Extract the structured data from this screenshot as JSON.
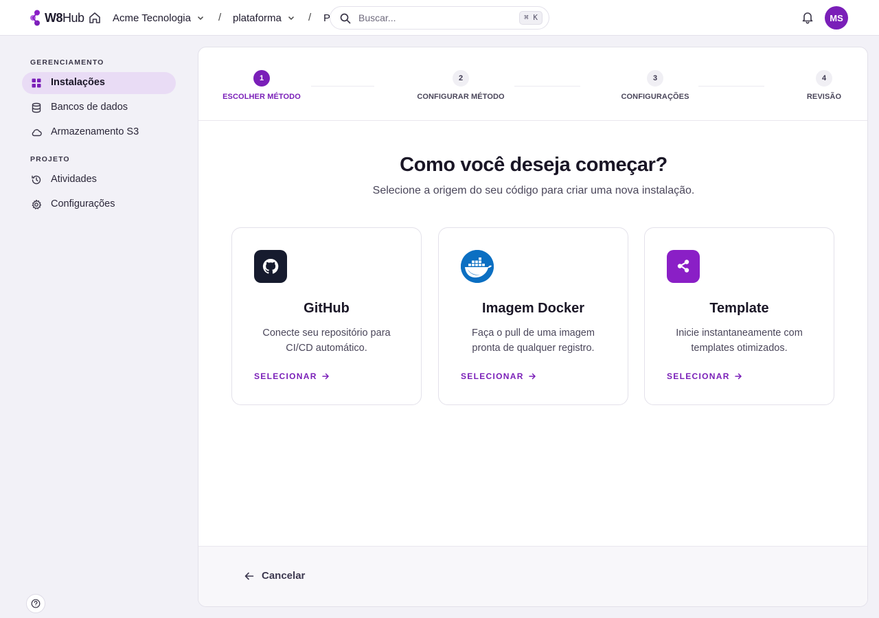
{
  "app": {
    "logo": {
      "bold": "W8",
      "light": "Hub"
    },
    "breadcrumb": [
      {
        "label": "Acme Tecnologia",
        "has_dropdown": true
      },
      {
        "label": "plataforma",
        "has_dropdown": true
      },
      {
        "label": "P",
        "has_dropdown": false
      }
    ],
    "separator": "/",
    "search": {
      "placeholder": "Buscar...",
      "shortcut": "⌘ K"
    },
    "user": {
      "initials": "MS"
    },
    "accent_color": "#7a1fb8"
  },
  "sidebar": {
    "sections": [
      {
        "label": "GERENCIAMENTO",
        "items": [
          {
            "label": "Instalações",
            "icon": "grid-icon",
            "active": true
          },
          {
            "label": "Bancos de dados",
            "icon": "database-icon",
            "active": false
          },
          {
            "label": "Armazenamento S3",
            "icon": "cloud-icon",
            "active": false
          }
        ]
      },
      {
        "label": "PROJETO",
        "items": [
          {
            "label": "Atividades",
            "icon": "history-icon",
            "active": false
          },
          {
            "label": "Configurações",
            "icon": "gear-icon",
            "active": false
          }
        ]
      }
    ]
  },
  "stepper": {
    "current_step": 1,
    "steps": [
      {
        "number": "1",
        "label": "ESCOLHER MÉTODO"
      },
      {
        "number": "2",
        "label": "CONFIGURAR MÉTODO"
      },
      {
        "number": "3",
        "label": "CONFIGURAÇÕES"
      },
      {
        "number": "4",
        "label": "REVISÃO"
      }
    ]
  },
  "main": {
    "title": "Como você deseja começar?",
    "subtitle": "Selecione a origem do seu código para criar uma nova instalação.",
    "cards": [
      {
        "title": "GitHub",
        "description": "Conecte seu repositório para CI/CD automático.",
        "action": "SELECIONAR",
        "icon": "github-icon",
        "icon_bg": "#161b2e"
      },
      {
        "title": "Imagem Docker",
        "description": "Faça o pull de uma imagem pronta de qualquer registro.",
        "action": "SELECIONAR",
        "icon": "docker-icon",
        "icon_bg": "#0b6fc2"
      },
      {
        "title": "Template",
        "description": "Inicie instantaneamente com templates otimizados.",
        "action": "SELECIONAR",
        "icon": "share-nodes-icon",
        "icon_bg": "#8a1fc6"
      }
    ]
  },
  "footer": {
    "cancel_label": "Cancelar"
  }
}
